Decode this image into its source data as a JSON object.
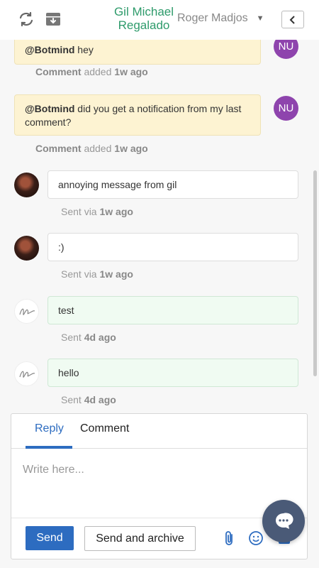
{
  "header": {
    "contact_name": "Gil Michael Regalado",
    "assignee": "Roger Madjos",
    "icons": {
      "sync": "sync-icon",
      "archive": "archive-icon",
      "collapse": "chevron-left-icon",
      "caret": "caret-down-icon"
    }
  },
  "thread": {
    "notes": [
      {
        "mention": "@Botmind",
        "text": " hey",
        "avatar": "NU",
        "meta_label": "Comment",
        "meta_mid": " added ",
        "meta_time": "1w ago"
      },
      {
        "mention": "@Botmind",
        "text": " did you get a notification from my last comment?",
        "avatar": "NU",
        "meta_label": "Comment",
        "meta_mid": " added ",
        "meta_time": "1w ago"
      }
    ],
    "messages": [
      {
        "text": "annoying message from gil",
        "meta_prefix": "Sent via ",
        "meta_time": "1w ago"
      },
      {
        "text": ":)",
        "meta_prefix": "Sent via ",
        "meta_time": "1w ago"
      },
      {
        "text": "test",
        "meta_prefix": "Sent ",
        "meta_time": "4d ago"
      },
      {
        "text": "hello",
        "meta_prefix": "Sent ",
        "meta_time": "4d ago"
      }
    ]
  },
  "composer": {
    "tabs": [
      "Reply",
      "Comment"
    ],
    "active_tab": "Reply",
    "placeholder": "Write here...",
    "send_label": "Send",
    "send_archive_label": "Send and archive",
    "icons": [
      "paperclip-icon",
      "emoji-icon",
      "keyboard-icon"
    ]
  },
  "colors": {
    "accent": "#2d6cc0",
    "contact": "#2e9b6b",
    "note_bg": "#fdf3d2",
    "avatar_nu": "#8e44ad",
    "chat_widget": "#4a5a77"
  }
}
